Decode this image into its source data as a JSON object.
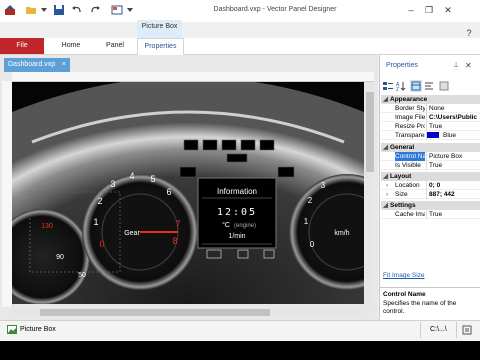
{
  "window": {
    "title": "Dashboard.vxp - Vector Panel Designer",
    "context_tab_group": "Picture Box"
  },
  "ribbon": {
    "tabs": [
      "File",
      "Home",
      "Panel",
      "Properties"
    ]
  },
  "document": {
    "tab_label": "Dashboard.vxp",
    "close_glyph": "×"
  },
  "dashboard": {
    "info_title": "Information",
    "clock": "12:05",
    "temp_unit": "°C",
    "temp_label": "(engine)",
    "rpm_unit": "1/min",
    "left_label": "Gear",
    "right_label": "km/h",
    "tacho_ticks": [
      "0",
      "1",
      "2",
      "3",
      "4",
      "5",
      "6",
      "7",
      "8"
    ],
    "temp_ticks": [
      "130",
      "90",
      "50"
    ],
    "speed_ticks": [
      "0",
      "1",
      "2",
      "3"
    ]
  },
  "properties_panel": {
    "title": "Properties",
    "categories": [
      {
        "name": "Appearance",
        "rows": [
          {
            "key": "Border Style",
            "value": "None"
          },
          {
            "key": "Image File",
            "value": "C:\\Users\\Public"
          },
          {
            "key": "Resize Pro",
            "value": "True"
          },
          {
            "key": "Transparency",
            "value": "Blue",
            "swatch": "#0000cc"
          }
        ]
      },
      {
        "name": "General",
        "rows": [
          {
            "key": "Control Name",
            "value": "Picture Box",
            "selected": true
          },
          {
            "key": "Is Visible",
            "value": "True"
          }
        ]
      },
      {
        "name": "Layout",
        "rows": [
          {
            "key": "Location",
            "value": "0; 0",
            "expandable": true
          },
          {
            "key": "Size",
            "value": "887; 442",
            "expandable": true
          }
        ]
      },
      {
        "name": "Settings",
        "rows": [
          {
            "key": "Cache Image",
            "value": "True"
          }
        ]
      }
    ],
    "link": "Fit Image Size",
    "description_title": "Control Name",
    "description_text": "Specifies the name of the control."
  },
  "status_bar": {
    "text": "Picture Box",
    "path": "C:\\...\\"
  },
  "colors": {
    "file_tab": "#c0262c",
    "accent": "#2b579a",
    "doc_tab": "#5f9fd8",
    "needle_red": "#e83020"
  }
}
